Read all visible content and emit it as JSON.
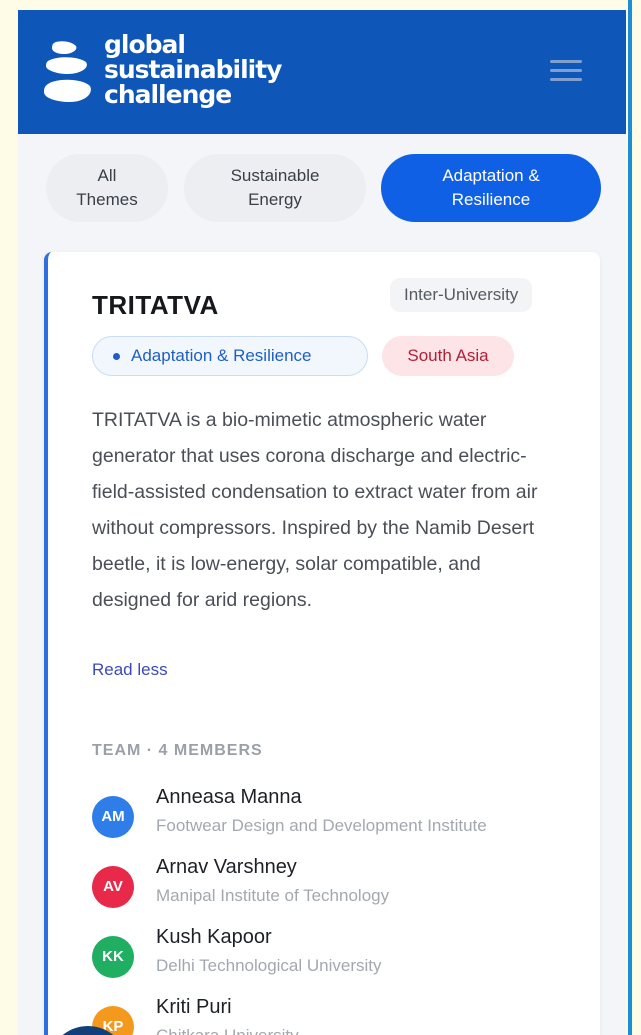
{
  "header": {
    "logo_lines": [
      "global",
      "sustainability",
      "challenge"
    ],
    "menu_icon": "hamburger-icon"
  },
  "tabs": [
    {
      "label_line1": "All",
      "label_line2": "Themes",
      "active": false
    },
    {
      "label_line1": "Sustainable",
      "label_line2": "Energy",
      "active": false
    },
    {
      "label_line1": "Adaptation &",
      "label_line2": "Resilience",
      "active": true
    }
  ],
  "project": {
    "title": "TRITATVA",
    "level": "Inter-University",
    "theme": "Adaptation & Resilience",
    "region": "South Asia",
    "description": "TRITATVA is a bio-mimetic atmospheric water generator that uses corona discharge and electric-field-assisted condensation to extract water from air without compressors. Inspired by the Namib Desert beetle, it is low-energy, solar compatible, and designed for arid regions.",
    "read_less": "Read less"
  },
  "team": {
    "label": "TEAM · 4 MEMBERS",
    "members": [
      {
        "initials": "AM",
        "name": "Anneasa Manna",
        "university": "Footwear Design and Development Institute",
        "color": "#2f7de8"
      },
      {
        "initials": "AV",
        "name": "Arnav Varshney",
        "university": "Manipal Institute of Technology",
        "color": "#e8294a"
      },
      {
        "initials": "KK",
        "name": "Kush Kapoor",
        "university": "Delhi Technological University",
        "color": "#1fae62"
      },
      {
        "initials": "KP",
        "name": "Kriti Puri",
        "university": "Chitkara University",
        "color": "#f39a1e"
      }
    ]
  },
  "colors": {
    "header_bg": "#0e57b8",
    "accent": "#1060e6"
  }
}
